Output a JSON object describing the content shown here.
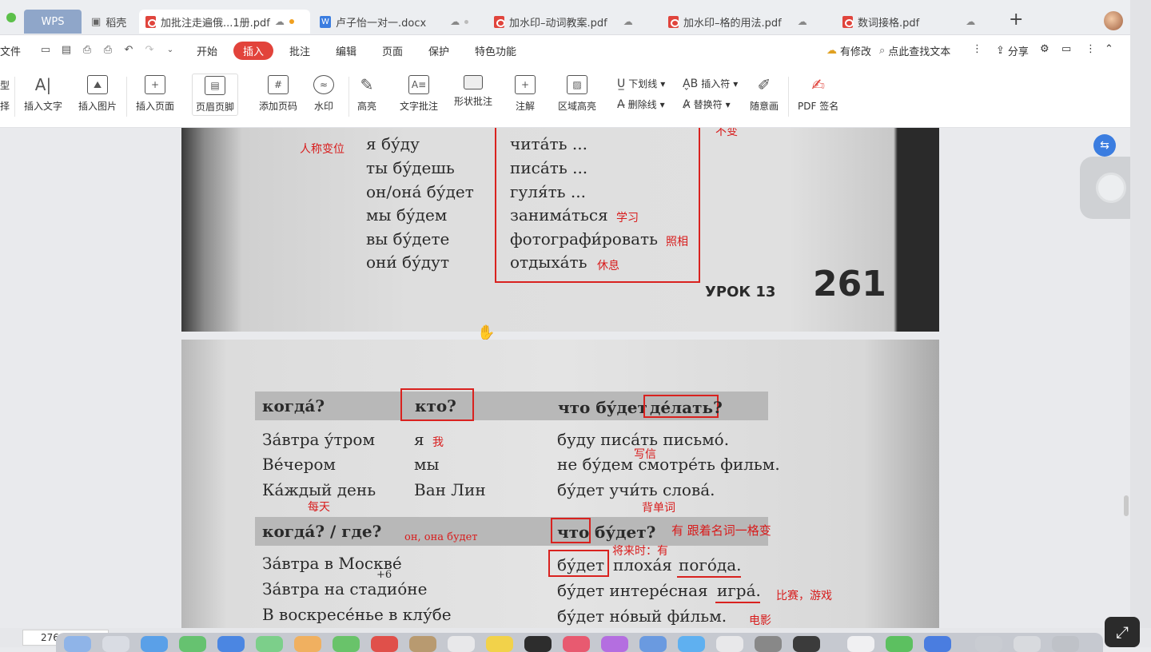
{
  "tabs": {
    "wps": "WPS",
    "daoke": "稻壳",
    "t1": "加批注走遍俄...1册.pdf",
    "t2": "卢子怡一对一.docx",
    "t3": "加水印–动词教案.pdf",
    "t4": "加水印–格的用法.pdf",
    "t5": "数词接格.pdf",
    "new_tab": "+"
  },
  "menu": {
    "file": "文件",
    "start": "开始",
    "insert": "插入",
    "annotate": "批注",
    "edit": "编辑",
    "page": "页面",
    "protect": "保护",
    "special": "特色功能",
    "modified": "有修改",
    "search": "点此查找文本",
    "share": "分享"
  },
  "ribbon": {
    "left_cut_1": "型",
    "left_cut_2": "择",
    "insert_text": "插入文字",
    "insert_image": "插入图片",
    "insert_page": "插入页面",
    "header_footer": "页眉页脚",
    "add_page_number": "添加页码",
    "watermark": "水印",
    "highlight": "高亮",
    "text_annotation": "文字批注",
    "shape_annotation": "形状批注",
    "note": "注解",
    "area_highlight": "区域高亮",
    "underline": "下划线",
    "strikethrough": "删除线",
    "insert_mark": "插入符",
    "replace_mark": "替换符",
    "freehand": "随意画",
    "pdf_sign": "PDF 签名"
  },
  "page1": {
    "ru_left": [
      "я бу́ду",
      "ты бу́дешь",
      "он/она́ бу́дет",
      "мы бу́дем",
      "вы бу́дете",
      "они́ бу́дут"
    ],
    "ru_right": [
      "чита́ть ...",
      "писа́ть ...",
      "гуля́ть ...",
      "занима́ться",
      "фотографи́ровать",
      "отдыха́ть"
    ],
    "zh_person": "人称变位",
    "zh_top_cut": "不变",
    "zh_study": "学习",
    "zh_photo": "照相",
    "zh_rest": "休息",
    "lesson": "УРОК 13",
    "page_number": "261"
  },
  "page2": {
    "h1_when": "когда́?",
    "h1_who": "кто?",
    "h1_what": "что бу́дет",
    "h1_do": "де́лать?",
    "rows1_when": [
      "За́втра у́тром",
      "Ве́чером",
      "Ка́ждый день"
    ],
    "rows1_who": [
      "я",
      "мы",
      "Ван Лин"
    ],
    "rows1_what": [
      "буду писа́ть письмо́.",
      "не бу́дем смотре́ть фильм.",
      "бу́дет учи́ть слова́."
    ],
    "zh_me": "我",
    "zh_write": "写信",
    "zh_everyday": "每天",
    "zh_words": "背单词",
    "h2_when": "когда́? / где?",
    "h2_on": "он, она будет",
    "h2_what": "что",
    "h2_budet": "бу́дет?",
    "zh_gen": "有 跟着名词一格变",
    "zh_future": "将来时：有",
    "rows2_where": [
      "За́втра в Москве́",
      "За́втра на стадио́не",
      "В воскресе́нье в клу́бе"
    ],
    "plus6": "+6",
    "row2a_budet": "бу́дет",
    "row2a_rest": "плоха́я",
    "row2a_word": "пого́да.",
    "row2b": "бу́дет интере́сная",
    "row2b_word": "игра́.",
    "zh_game": "比赛，游戏",
    "row2c": "бу́дет но́вый фи́льм.",
    "zh_movie": "电影"
  },
  "status": {
    "page_field": "276"
  }
}
